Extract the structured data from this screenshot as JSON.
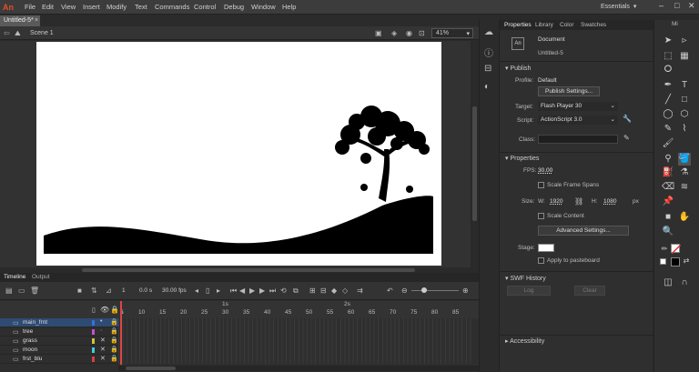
{
  "app": {
    "logo": "An"
  },
  "menu": [
    "File",
    "Edit",
    "View",
    "Insert",
    "Modify",
    "Text",
    "Commands",
    "Control",
    "Debug",
    "Window",
    "Help"
  ],
  "workspace": "Essentials",
  "doc_tab": "Untitled-5*",
  "scene": {
    "label": "Scene 1",
    "zoom": "41%"
  },
  "timeline": {
    "tabs": [
      "Timeline",
      "Output"
    ],
    "fps": "30.00 fps",
    "time": "0.0 s",
    "frame_current": "1",
    "ruler_numbers": [
      "1",
      "5",
      "10",
      "15",
      "20",
      "25",
      "30",
      "35",
      "40",
      "45",
      "50",
      "55",
      "60",
      "65",
      "70",
      "75",
      "80",
      "85"
    ],
    "ruler_seconds": [
      "1s",
      "2s"
    ],
    "layers": [
      {
        "name": "main_frnt",
        "color": "#3a6fd8",
        "active": true
      },
      {
        "name": "tree",
        "color": "#c84fd0",
        "active": false
      },
      {
        "name": "grass",
        "color": "#d6c13b",
        "active": false
      },
      {
        "name": "moon",
        "color": "#3ed0d8",
        "active": false
      },
      {
        "name": "frst_blu",
        "color": "#d84040",
        "active": false
      }
    ]
  },
  "properties": {
    "tabs": [
      "Properties",
      "Library",
      "Color",
      "Swatches"
    ],
    "doc_type": "Document",
    "doc_name": "Untitled-5",
    "publish_title": "Publish",
    "profile_label": "Profile:",
    "profile_value": "Default",
    "publish_settings": "Publish Settings...",
    "target_label": "Target:",
    "target_value": "Flash Player 30",
    "script_label": "Script:",
    "script_value": "ActionScript 3.0",
    "class_label": "Class:",
    "props_title": "Properties",
    "fps_label": "FPS:",
    "fps_value": "30.00",
    "scale_spans": "Scale Frame Spans",
    "size_label": "Size:",
    "w_label": "W:",
    "w_value": "1920",
    "h_label": "H:",
    "h_value": "1080",
    "px": "px",
    "scale_content": "Scale Content",
    "advanced": "Advanced Settings...",
    "stage_label": "Stage:",
    "apply_paste": "Apply to pasteboard",
    "swf_title": "SWF History",
    "log": "Log",
    "clear": "Clear",
    "accessibility": "Accessibility"
  },
  "tools_header": "Mi"
}
